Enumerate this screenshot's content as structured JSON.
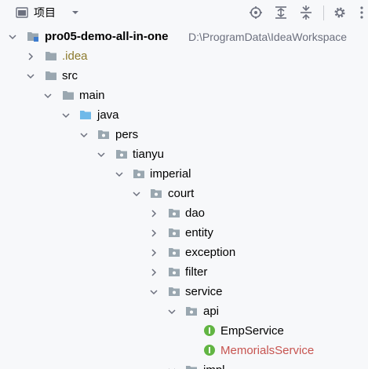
{
  "toolbar": {
    "title": "项目",
    "icons": [
      "project-view-icon",
      "chevron-down-icon",
      "locate-icon",
      "expand-all-icon",
      "collapse-all-icon",
      "gear-icon",
      "more-icon"
    ]
  },
  "colors": {
    "folder": "#9aa7b0",
    "source_folder": "#6fb9e9",
    "interface_badge": "#62b543",
    "idea_text": "#8c7a2c",
    "modified_text": "#c75450",
    "path_text": "#6c707e"
  },
  "tree": {
    "rows": [
      {
        "label": "pro05-demo-all-in-one",
        "path": "D:\\ProgramData\\IdeaWorkspace"
      },
      {
        "label": ".idea"
      },
      {
        "label": "src"
      },
      {
        "label": "main"
      },
      {
        "label": "java"
      },
      {
        "label": "pers"
      },
      {
        "label": "tianyu"
      },
      {
        "label": "imperial"
      },
      {
        "label": "court"
      },
      {
        "label": "dao"
      },
      {
        "label": "entity"
      },
      {
        "label": "exception"
      },
      {
        "label": "filter"
      },
      {
        "label": "service"
      },
      {
        "label": "api"
      },
      {
        "label": "EmpService"
      },
      {
        "label": "MemorialsService"
      },
      {
        "label": "impl"
      }
    ]
  }
}
